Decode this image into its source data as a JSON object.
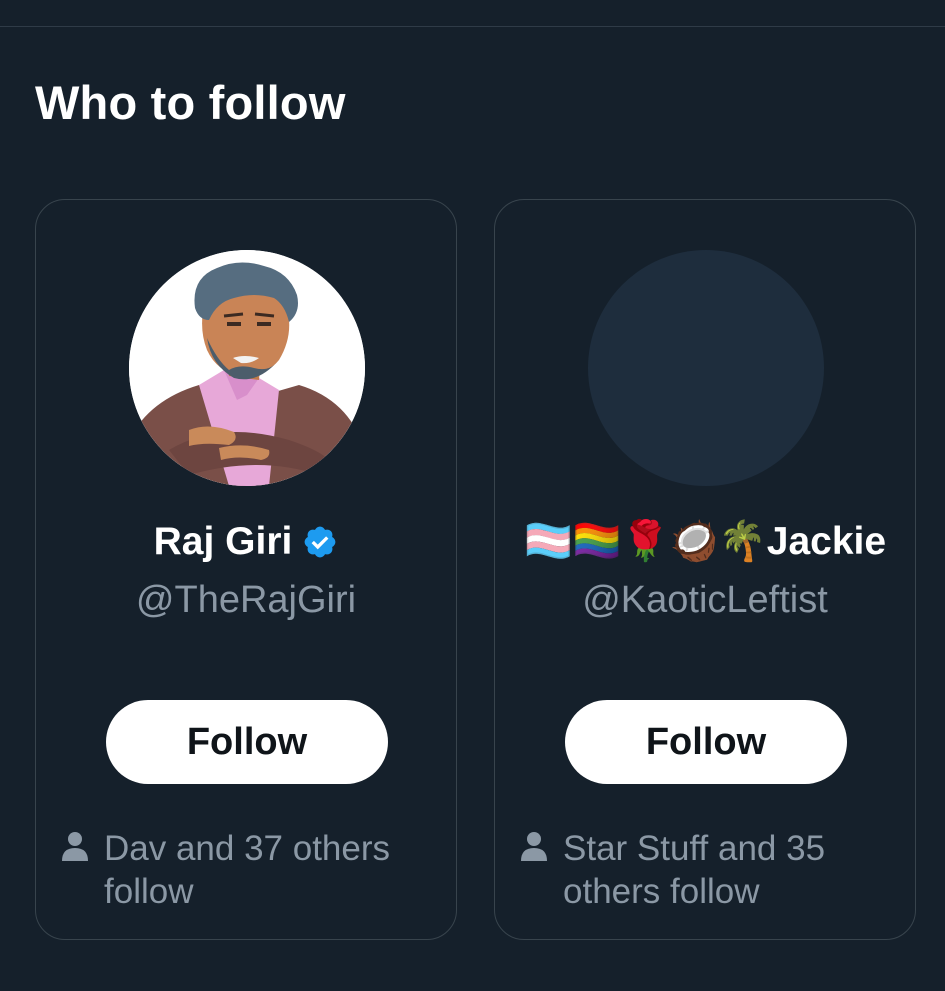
{
  "section": {
    "title": "Who to follow"
  },
  "suggestions": [
    {
      "name": "Raj Giri",
      "handle": "@TheRajGiri",
      "verified": true,
      "follow_label": "Follow",
      "social_context": "Dav and 37 others follow"
    },
    {
      "name": "🏳️‍⚧️🏳️‍🌈🌹🥥🌴Jackie",
      "handle": "@KaoticLeftist",
      "verified": false,
      "follow_label": "Follow",
      "social_context": "Star Stuff and 35 others follow"
    }
  ],
  "icons": {
    "verified": "verified-badge-icon",
    "person": "person-icon"
  },
  "colors": {
    "background": "#15202b",
    "card_border": "#38444d",
    "secondary_text": "#8b98a5",
    "verified_blue": "#1d9bf0",
    "button_bg": "#ffffff",
    "button_text": "#0f1419"
  }
}
